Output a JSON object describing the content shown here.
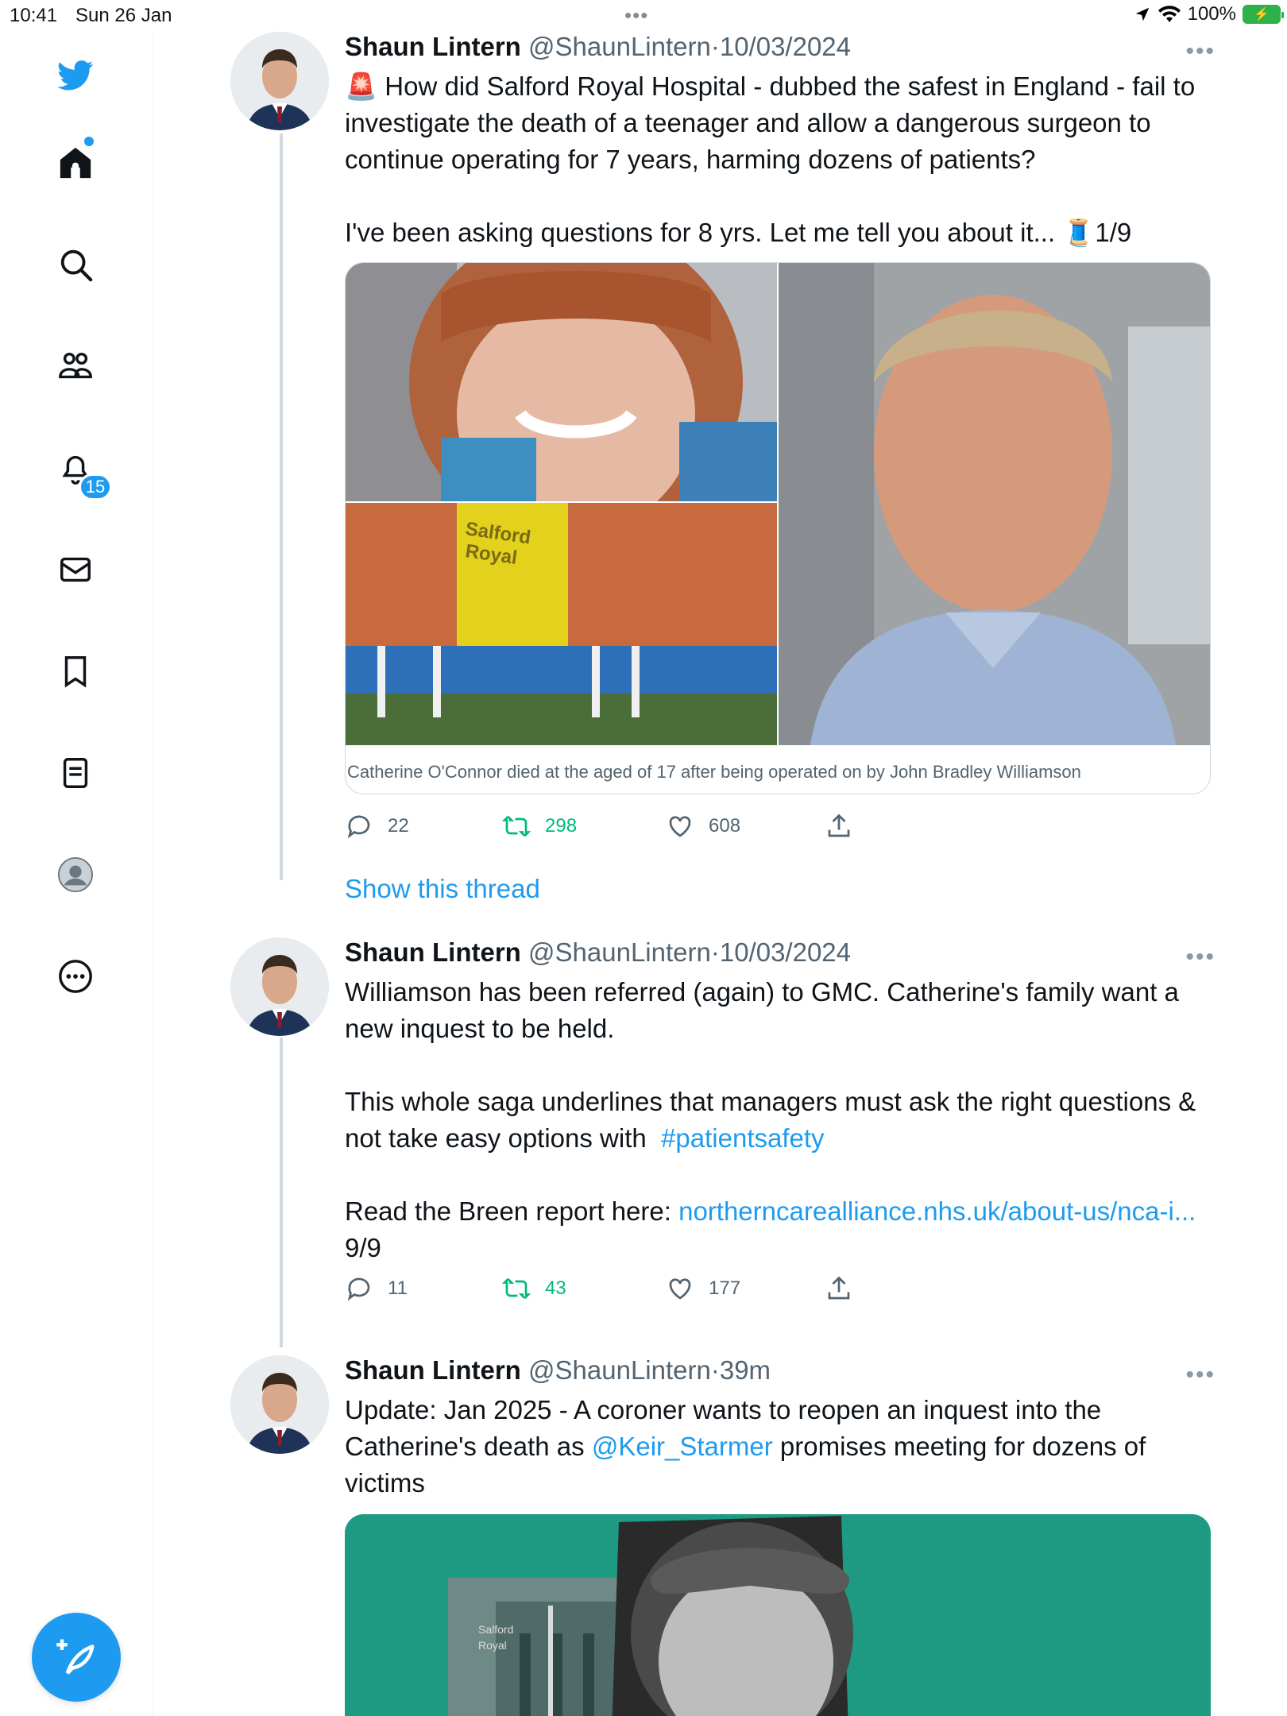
{
  "status_bar": {
    "time": "10:41",
    "date": "Sun 26 Jan",
    "battery": "100%"
  },
  "sidebar": {
    "notifications_badge": "15",
    "items": [
      "twitter-logo",
      "home",
      "search",
      "communities",
      "notifications",
      "messages",
      "bookmarks",
      "lists",
      "profile",
      "more"
    ]
  },
  "tweets": [
    {
      "name": "Shaun Lintern",
      "handle": "@ShaunLintern",
      "sep": "·",
      "timestamp": "10/03/2024",
      "text_emoji": "🚨",
      "text": " How did Salford Royal Hospital - dubbed the safest in England - fail to investigate the death of a teenager and allow a dangerous surgeon to continue operating for 7 years, harming dozens of patients?\n\nI've been asking questions for 8 yrs. Let me tell you about it... 🧵1/9",
      "media_caption": "Catherine O'Connor died at the aged of 17 after being operated on by John Bradley Williamson",
      "media_sign": "Salford\nRoyal",
      "replies": "22",
      "retweets": "298",
      "likes": "608"
    },
    {
      "name": "Shaun Lintern",
      "handle": "@ShaunLintern",
      "sep": "·",
      "timestamp": "10/03/2024",
      "text_a": "Williamson has been referred (again) to GMC. Catherine's family want a new inquest to be held.\n\nThis whole saga underlines that managers must ask the right questions & not take easy options with  ",
      "hashtag": "#patientsafety",
      "text_b": "\n\nRead the Breen report here: ",
      "link": "northerncarealliance.nhs.uk/about-us/nca-i...",
      "text_c": " 9/9",
      "replies": "11",
      "retweets": "43",
      "likes": "177"
    },
    {
      "name": "Shaun Lintern",
      "handle": "@ShaunLintern",
      "sep": "·",
      "timestamp": "39m",
      "text_a": "Update: Jan 2025 - A coroner wants to reopen an inquest into the Catherine's death as ",
      "mention": "@Keir_Starmer",
      "text_b": " promises meeting for dozens of victims",
      "media_sign": "Salford\nRoyal"
    }
  ],
  "show_thread": "Show this thread",
  "colors": {
    "accent": "#1d9bf0",
    "retweet": "#00ba7c",
    "muted": "#536471"
  }
}
